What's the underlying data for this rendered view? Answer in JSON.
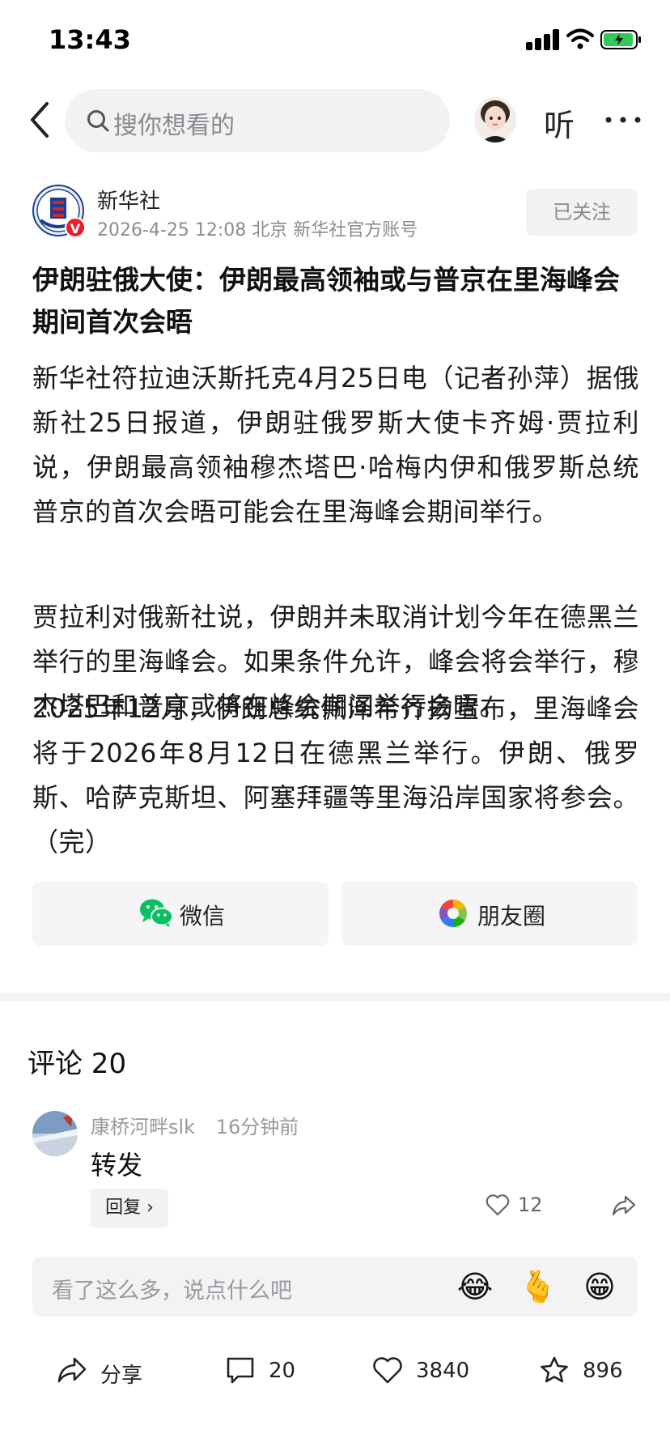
{
  "status": {
    "time": "13:43"
  },
  "header": {
    "search_placeholder": "搜你想看的",
    "listen_label": "听"
  },
  "author": {
    "name": "新华社",
    "badge": "V",
    "meta": "2026-4-25  12:08  北京  新华社官方账号",
    "follow_label": "已关注"
  },
  "article": {
    "title": "伊朗驻俄大使：伊朗最高领袖或与普京在里海峰会期间首次会晤",
    "paragraphs": [
      "新华社符拉迪沃斯托克4月25日电（记者孙萍）据俄新社25日报道，伊朗驻俄罗斯大使卡齐姆·贾拉利说，伊朗最高领袖穆杰塔巴·哈梅内伊和俄罗斯总统普京的首次会晤可能会在里海峰会期间举行。",
      "贾拉利对俄新社说，伊朗并未取消计划今年在德黑兰举行的里海峰会。如果条件允许，峰会将会举行，穆杰塔巴和普京或将在峰会期间举行会晤。",
      "2025年12月，伊朗总统佩泽希齐扬宣布，里海峰会将于2026年8月12日在德黑兰举行。伊朗、俄罗斯、哈萨克斯坦、阿塞拜疆等里海沿岸国家将参会。（完）"
    ]
  },
  "share": {
    "wechat_label": "微信",
    "moments_label": "朋友圈",
    "colors": {
      "wechat": "#07c160"
    }
  },
  "comments": {
    "title": "评论 20",
    "items": [
      {
        "user": "康桥河畔slk",
        "time": "16分钟前",
        "text": "转发",
        "reply_label": "回复 ›",
        "likes": "12"
      }
    ]
  },
  "comment_input": {
    "placeholder": "看了这么多，说点什么吧",
    "emojis": [
      "😂",
      "🫰",
      "😁"
    ]
  },
  "bottom_bar": {
    "share_label": "分享",
    "comment_count": "20",
    "like_count": "3840",
    "favorite_count": "896"
  }
}
